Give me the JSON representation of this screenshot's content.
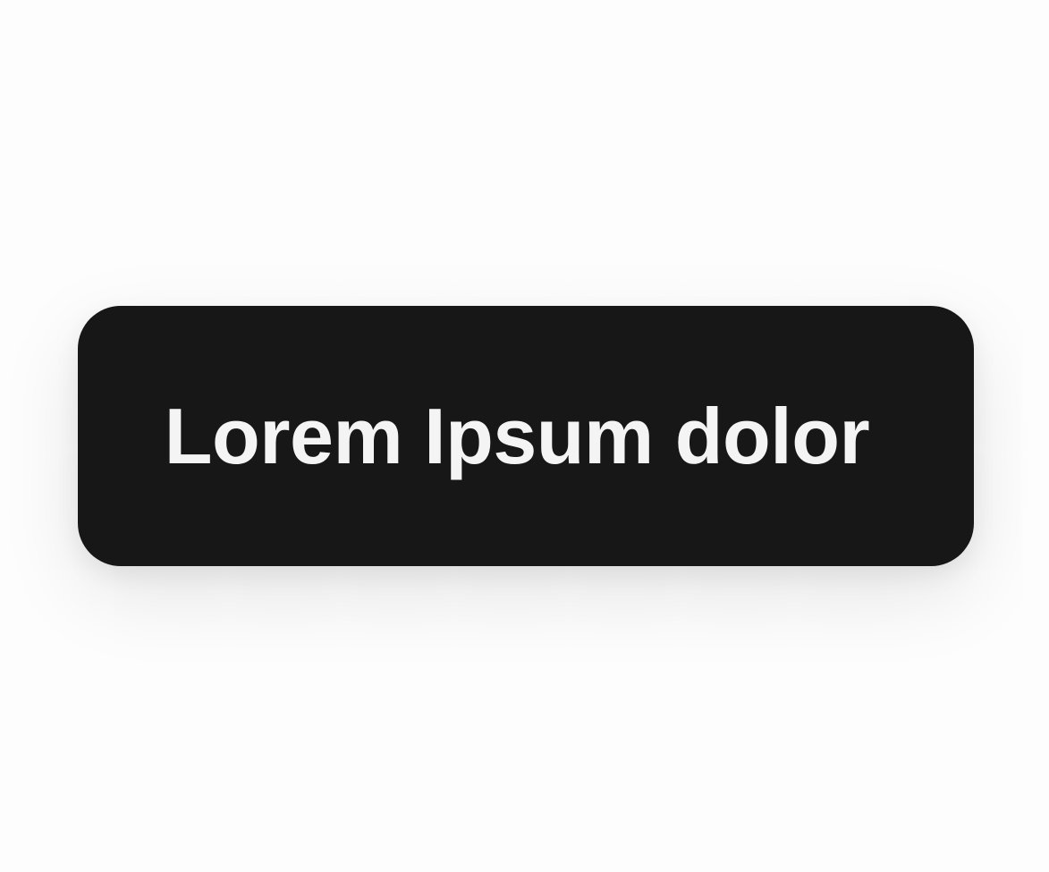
{
  "button": {
    "label": "Lorem Ipsum dolor",
    "background_color": "#171717",
    "text_color": "#f4f4f4"
  },
  "page": {
    "background_color": "#fdfdfd"
  }
}
